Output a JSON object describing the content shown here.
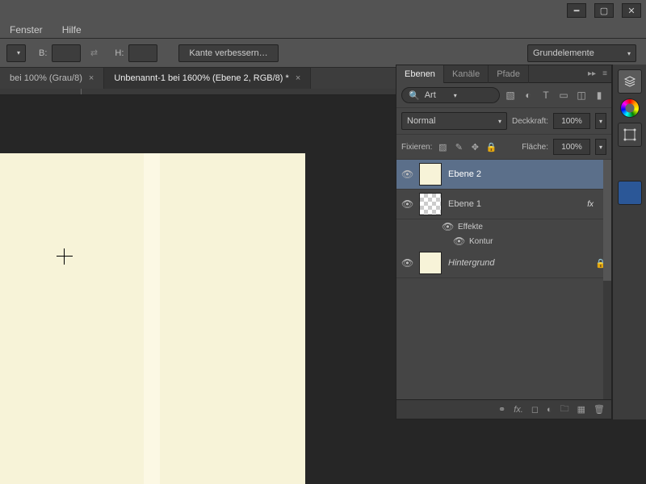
{
  "menu": {
    "fenster": "Fenster",
    "hilfe": "Hilfe"
  },
  "optbar": {
    "b_label": "B:",
    "h_label": "H:",
    "refine": "Kante verbessern…",
    "workspace": "Grundelemente"
  },
  "tabs": [
    {
      "title": "bei 100% (Grau/8)",
      "active": false
    },
    {
      "title": "Unbenannt-1 bei 1600% (Ebene 2, RGB/8) *",
      "active": true
    }
  ],
  "panel": {
    "tabs": {
      "ebenen": "Ebenen",
      "kanaele": "Kanäle",
      "pfade": "Pfade"
    },
    "search_label": "Art",
    "blend_mode": "Normal",
    "opacity_label": "Deckkraft:",
    "opacity_value": "100%",
    "lock_label": "Fixieren:",
    "fill_label": "Fläche:",
    "fill_value": "100%",
    "layers": [
      {
        "name": "Ebene 2",
        "selected": true,
        "checker": false
      },
      {
        "name": "Ebene 1",
        "selected": false,
        "checker": true,
        "fx": true
      },
      {
        "name": "Hintergrund",
        "selected": false,
        "locked": true,
        "italic": true
      }
    ],
    "sub": {
      "effekte": "Effekte",
      "kontur": "Kontur"
    }
  }
}
